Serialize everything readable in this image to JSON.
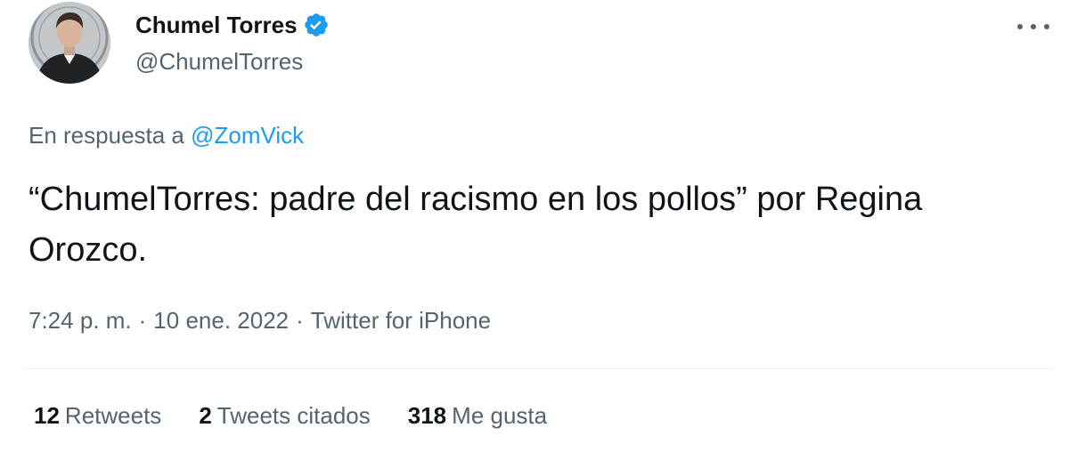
{
  "author": {
    "display_name": "Chumel Torres",
    "handle": "@ChumelTorres",
    "verified": true
  },
  "reply": {
    "prefix": "En respuesta a",
    "mention": "@ZomVick"
  },
  "tweet": {
    "text": "“ChumelTorres: padre del racismo en los pollos” por Regina Orozco."
  },
  "meta": {
    "time": "7:24 p. m.",
    "separator": "·",
    "date": "10 ene. 2022",
    "source": "Twitter for iPhone"
  },
  "stats": {
    "retweets_count": "12",
    "retweets_label": "Retweets",
    "quotes_count": "2",
    "quotes_label": "Tweets citados",
    "likes_count": "318",
    "likes_label": "Me gusta"
  },
  "colors": {
    "link": "#1d9bf0",
    "secondary_text": "#536471",
    "primary_text": "#0f1419"
  },
  "icons": {
    "verified": "verified-badge-icon",
    "more": "more-options-icon"
  }
}
